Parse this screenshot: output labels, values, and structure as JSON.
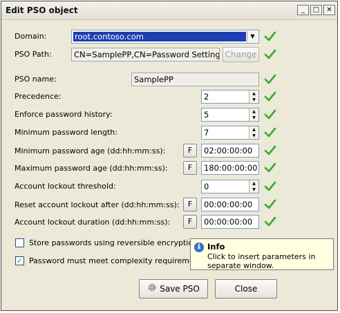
{
  "window": {
    "title": "Edit PSO object",
    "minimize": "_",
    "maximize": "□",
    "close": "✕"
  },
  "fields": {
    "domain_label": "Domain:",
    "domain_value": "root.contoso.com",
    "pso_path_label": "PSO Path:",
    "pso_path_value": "CN=SamplePP,CN=Password Settings Conta",
    "change_button": "Change",
    "pso_name_label": "PSO name:",
    "pso_name_value": "SamplePP",
    "precedence_label": "Precedence:",
    "precedence_value": "2",
    "history_label": "Enforce password history:",
    "history_value": "5",
    "minlen_label": "Minimum password length:",
    "minlen_value": "7",
    "minage_label": "Minimum password age (dd:hh:mm:ss):",
    "minage_value": "02:00:00:00",
    "maxage_label": "Maximum password age (dd:hh:mm:ss):",
    "maxage_value": "180:00:00:00",
    "lockout_threshold_label": "Account lockout threshold:",
    "lockout_threshold_value": "0",
    "reset_lockout_label": "Reset account lockout after (dd:hh:mm:ss):",
    "reset_lockout_value": "00:00:00:00",
    "lockout_duration_label": "Account lockout duration (dd:hh:mm:ss):",
    "lockout_duration_value": "00:00:00:00",
    "f_button": "F"
  },
  "checkboxes": {
    "reversible_label": "Store passwords using reversible encryption",
    "reversible_checked": false,
    "complexity_label": "Password must meet complexity requirements",
    "complexity_checked": true,
    "checkmark": "✓"
  },
  "tooltip": {
    "icon": "i",
    "title": "Info",
    "body": "Click to insert parameters in separate window."
  },
  "buttons": {
    "save": "Save PSO",
    "close": "Close"
  },
  "colors": {
    "valid_check": "#3aa534",
    "selection": "#1e3fb0"
  }
}
